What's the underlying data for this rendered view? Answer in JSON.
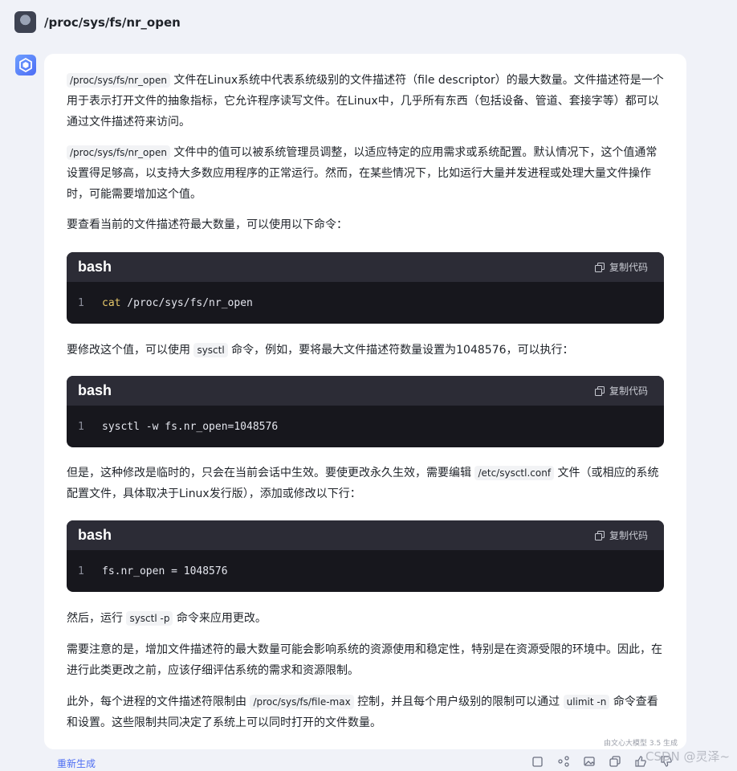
{
  "user": {
    "query": "/proc/sys/fs/nr_open"
  },
  "answer": {
    "p1": {
      "code": "/proc/sys/fs/nr_open",
      "text": "文件在Linux系统中代表系统级别的文件描述符（file descriptor）的最大数量。文件描述符是一个用于表示打开文件的抽象指标，它允许程序读写文件。在Linux中，几乎所有东西（包括设备、管道、套接字等）都可以通过文件描述符来访问。"
    },
    "p2": {
      "code": "/proc/sys/fs/nr_open",
      "text": "文件中的值可以被系统管理员调整，以适应特定的应用需求或系统配置。默认情况下，这个值通常设置得足够高，以支持大多数应用程序的正常运行。然而，在某些情况下，比如运行大量并发进程或处理大量文件操作时，可能需要增加这个值。"
    },
    "p3": {
      "text": "要查看当前的文件描述符最大数量，可以使用以下命令："
    },
    "code1": {
      "lang": "bash",
      "copy": "复制代码",
      "line_no": "1",
      "keyword": "cat",
      "rest": " /proc/sys/fs/nr_open"
    },
    "p4": {
      "a": "要修改这个值，可以使用",
      "code": "sysctl",
      "b": "命令，例如，要将最大文件描述符数量设置为1048576，可以执行："
    },
    "code2": {
      "lang": "bash",
      "copy": "复制代码",
      "line_no": "1",
      "text": "sysctl -w fs.nr_open=1048576"
    },
    "p5": {
      "a": "但是，这种修改是临时的，只会在当前会话中生效。要使更改永久生效，需要编辑",
      "code": "/etc/sysctl.conf",
      "b": "文件（或相应的系统配置文件，具体取决于Linux发行版），添加或修改以下行："
    },
    "code3": {
      "lang": "bash",
      "copy": "复制代码",
      "line_no": "1",
      "text": "fs.nr_open = 1048576"
    },
    "p6": {
      "a": "然后，运行",
      "code": "sysctl -p",
      "b": "命令来应用更改。"
    },
    "p7": {
      "text": "需要注意的是，增加文件描述符的最大数量可能会影响系统的资源使用和稳定性，特别是在资源受限的环境中。因此，在进行此类更改之前，应该仔细评估系统的需求和资源限制。"
    },
    "p8": {
      "a": "此外，每个进程的文件描述符限制由",
      "code1": "/proc/sys/fs/file-max",
      "b": "控制，并且每个用户级别的限制可以通过",
      "code2": "ulimit -n",
      "c": "命令查看和设置。这些限制共同决定了系统上可以同时打开的文件数量。"
    }
  },
  "footer": {
    "generated_by": "由文心大模型 3.5 生成",
    "regenerate": "重新生成",
    "watermark": "CSDN @灵泽~"
  },
  "icons": [
    "copy-icon",
    "share-icon",
    "image-icon",
    "duplicate-icon",
    "thumbs-up-icon",
    "thumbs-down-icon"
  ]
}
